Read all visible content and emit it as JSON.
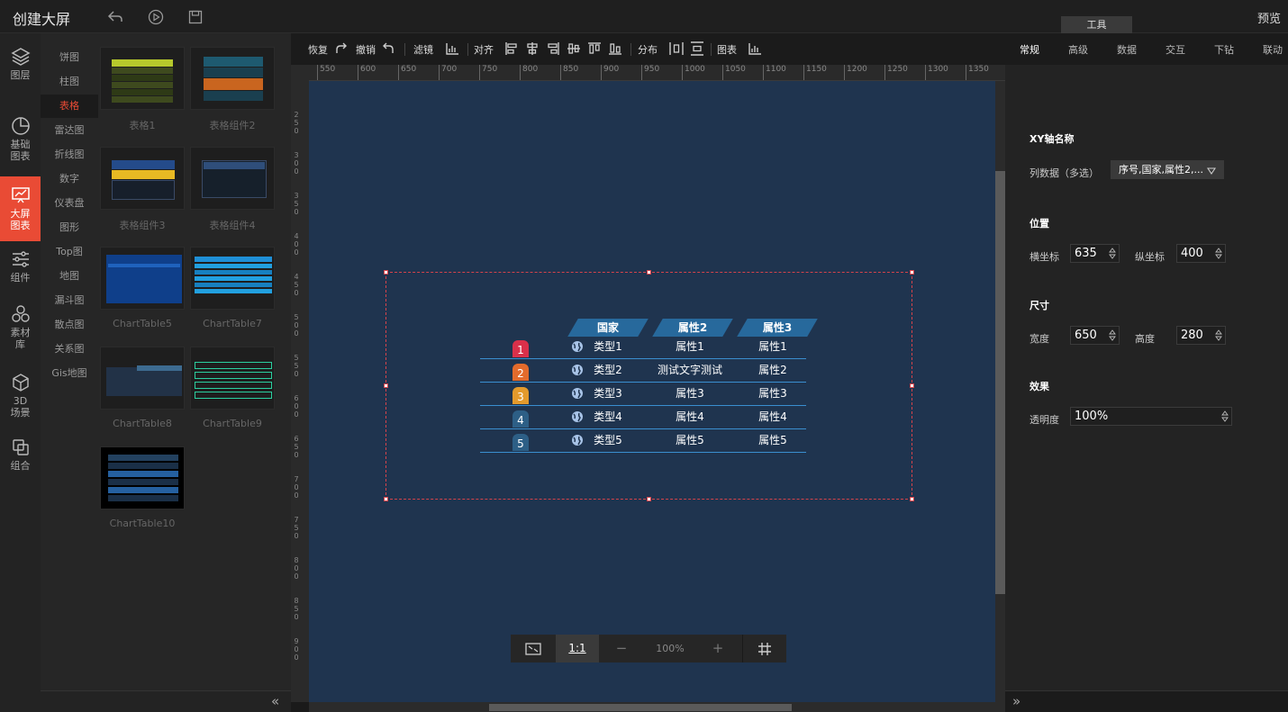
{
  "header": {
    "title": "创建大屏",
    "preview": "预览",
    "tools_tab": "工具"
  },
  "rail": [
    {
      "label": "图层",
      "icon": "layers-icon"
    },
    {
      "label": "基础图表",
      "icon": "pie-chart-icon"
    },
    {
      "label": "大屏图表",
      "icon": "screen-chart-icon",
      "active": true
    },
    {
      "label": "组件",
      "icon": "sliders-icon"
    },
    {
      "label": "素材库",
      "icon": "circles-icon"
    },
    {
      "label": "3D场景",
      "icon": "cube-icon"
    },
    {
      "label": "组合",
      "icon": "group-icon"
    }
  ],
  "categories": [
    "饼图",
    "柱图",
    "表格",
    "雷达图",
    "折线图",
    "数字",
    "仪表盘",
    "图形",
    "Top图",
    "地图",
    "漏斗图",
    "散点图",
    "关系图",
    "Gis地图"
  ],
  "active_category": "表格",
  "thumbnails": [
    "表格1",
    "表格组件2",
    "表格组件3",
    "表格组件4",
    "ChartTable5",
    "ChartTable7",
    "ChartTable8",
    "ChartTable9",
    "ChartTable10"
  ],
  "toolbar": {
    "redo": "恢复",
    "undo": "撤销",
    "filter": "滤镜",
    "align": "对齐",
    "distribute": "分布",
    "chart": "图表"
  },
  "ruler_top": [
    "550",
    "600",
    "650",
    "700",
    "750",
    "800",
    "850",
    "900",
    "950",
    "1000",
    "1050",
    "1100",
    "1150",
    "1200",
    "1250",
    "1300",
    "1350"
  ],
  "ruler_left": [
    "250",
    "300",
    "350",
    "400",
    "450",
    "500",
    "550",
    "600",
    "650",
    "700",
    "750",
    "800",
    "850",
    "900"
  ],
  "table_widget": {
    "headers": [
      "国家",
      "属性2",
      "属性3"
    ],
    "rows": [
      {
        "rank": "1",
        "type": "类型1",
        "attr2": "属性1",
        "attr3": "属性1",
        "color": "#d9304a"
      },
      {
        "rank": "2",
        "type": "类型2",
        "attr2": "测试文字测试",
        "attr3": "属性2",
        "color": "#e36b2c"
      },
      {
        "rank": "3",
        "type": "类型3",
        "attr2": "属性3",
        "attr3": "属性3",
        "color": "#e39a2c"
      },
      {
        "rank": "4",
        "type": "类型4",
        "attr2": "属性4",
        "attr3": "属性4",
        "color": "#2d5f86"
      },
      {
        "rank": "5",
        "type": "类型5",
        "attr2": "属性5",
        "attr3": "属性5",
        "color": "#2d5f86"
      }
    ]
  },
  "zoom": {
    "one_to_one": "1:1",
    "minus": "−",
    "level": "100%",
    "plus": "+"
  },
  "right_tabs": [
    "常规",
    "高级",
    "数据",
    "交互",
    "下钻",
    "联动"
  ],
  "active_right_tab": "常规",
  "panel": {
    "xy_title": "XY轴名称",
    "col_label": "列数据（多选）",
    "col_value": "序号,国家,属性2,...",
    "pos_title": "位置",
    "x_label": "横坐标",
    "x_value": "635",
    "y_label": "纵坐标",
    "y_value": "400",
    "size_title": "尺寸",
    "w_label": "宽度",
    "w_value": "650",
    "h_label": "高度",
    "h_value": "280",
    "effect_title": "效果",
    "opacity_label": "透明度",
    "opacity_value": "100%"
  },
  "colors": {
    "accent": "#e94b35",
    "canvas": "#1f344f",
    "header_blue": "#2b7bb6"
  }
}
